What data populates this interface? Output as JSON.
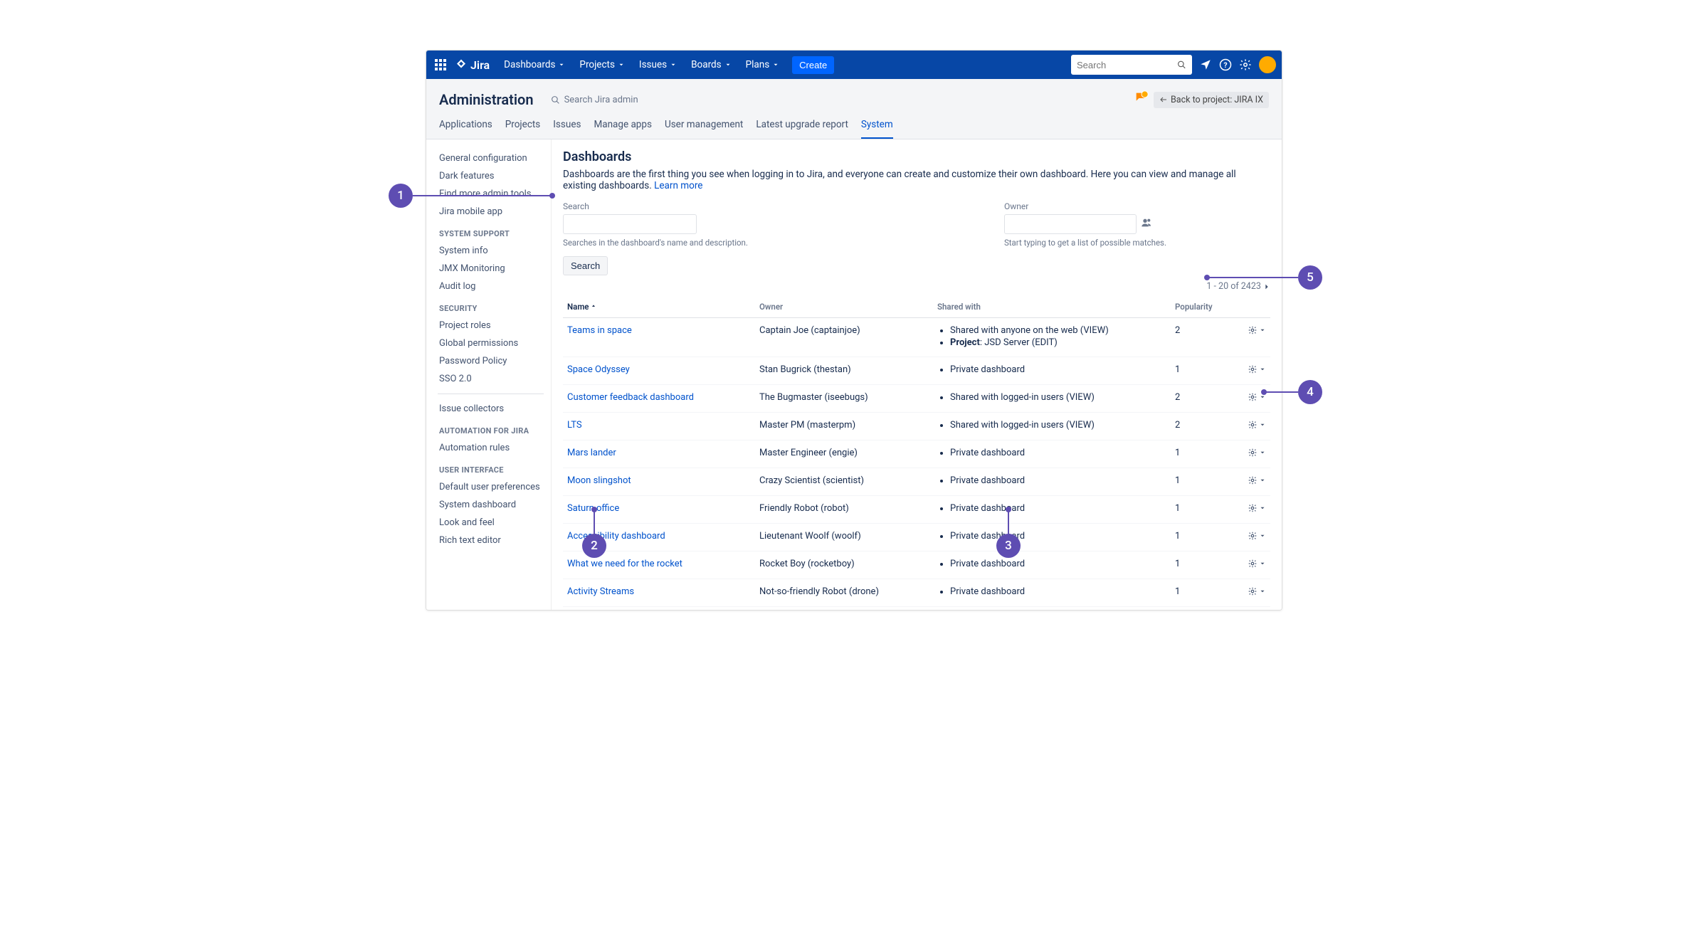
{
  "nav": {
    "items": [
      "Dashboards",
      "Projects",
      "Issues",
      "Boards",
      "Plans"
    ],
    "create": "Create",
    "search_placeholder": "Search"
  },
  "admin": {
    "title": "Administration",
    "search_label": "Search Jira admin",
    "back_label": "Back to project: JIRA IX",
    "tabs": [
      "Applications",
      "Projects",
      "Issues",
      "Manage apps",
      "User management",
      "Latest upgrade report",
      "System"
    ],
    "active_tab": "System"
  },
  "sidebar": {
    "top": [
      "General configuration",
      "Dark features",
      "Find more admin tools",
      "Jira mobile app"
    ],
    "groups": [
      {
        "heading": "SYSTEM SUPPORT",
        "items": [
          "System info",
          "JMX Monitoring",
          "Audit log"
        ]
      },
      {
        "heading": "SECURITY",
        "items": [
          "Project roles",
          "Global permissions",
          "Password Policy",
          "SSO 2.0"
        ]
      }
    ],
    "collectors": "Issue collectors",
    "groups2": [
      {
        "heading": "AUTOMATION FOR JIRA",
        "items": [
          "Automation rules"
        ]
      },
      {
        "heading": "USER INTERFACE",
        "items": [
          "Default user preferences",
          "System dashboard",
          "Look and feel",
          "Rich text editor"
        ]
      }
    ]
  },
  "page": {
    "title": "Dashboards",
    "desc": "Dashboards are the first thing you see when logging in to Jira, and everyone can create and customize their own dashboard. Here you can view and manage all existing dashboards. ",
    "learn_more": "Learn more",
    "search_label": "Search",
    "search_hint": "Searches in the dashboard's name and description.",
    "owner_label": "Owner",
    "owner_hint": "Start typing to get a list of possible matches.",
    "search_button": "Search",
    "pager": "1 - 20 of 2423",
    "columns": {
      "name": "Name",
      "owner": "Owner",
      "shared": "Shared with",
      "popularity": "Popularity"
    }
  },
  "rows": [
    {
      "name": "Teams in space",
      "owner": "Captain Joe (captainjoe)",
      "shared": "<ul><li>Shared with anyone on the web (VIEW)</li><li><strong>Project</strong>: JSD Server (EDIT)</li></ul>",
      "pop": "2"
    },
    {
      "name": "Space Odyssey",
      "owner": "Stan Bugrick (thestan)",
      "shared": "<ul><li>Private dashboard</li></ul>",
      "pop": "1"
    },
    {
      "name": "Customer feedback dashboard",
      "owner": "The Bugmaster (iseebugs)",
      "shared": "<ul><li>Shared with logged-in users (VIEW)</li></ul>",
      "pop": "2"
    },
    {
      "name": "LTS",
      "owner": "Master PM (masterpm)",
      "shared": "<ul><li>Shared with logged-in users (VIEW)</li></ul>",
      "pop": "2"
    },
    {
      "name": "Mars lander",
      "owner": "Master Engineer (engie)",
      "shared": "<ul><li>Private dashboard</li></ul>",
      "pop": "1"
    },
    {
      "name": "Moon slingshot",
      "owner": "Crazy Scientist (scientist)",
      "shared": "<ul><li>Private dashboard</li></ul>",
      "pop": "1"
    },
    {
      "name": "Saturn office",
      "owner": "Friendly Robot (robot)",
      "shared": "<ul><li>Private dashboard</li></ul>",
      "pop": "1"
    },
    {
      "name": "Accessibility dashboard",
      "owner": "Lieutenant Woolf (woolf)",
      "shared": "<ul><li>Private dashboard</li></ul>",
      "pop": "1"
    },
    {
      "name": "What we need for the rocket",
      "owner": "Rocket Boy (rocketboy)",
      "shared": "<ul><li>Private dashboard</li></ul>",
      "pop": "1"
    },
    {
      "name": "Activity Streams",
      "owner": "Not-so-friendly Robot (drone)",
      "shared": "<ul><li>Private dashboard</li></ul>",
      "pop": "1"
    }
  ],
  "callouts": {
    "c1": "1",
    "c2": "2",
    "c3": "3",
    "c4": "4",
    "c5": "5"
  }
}
